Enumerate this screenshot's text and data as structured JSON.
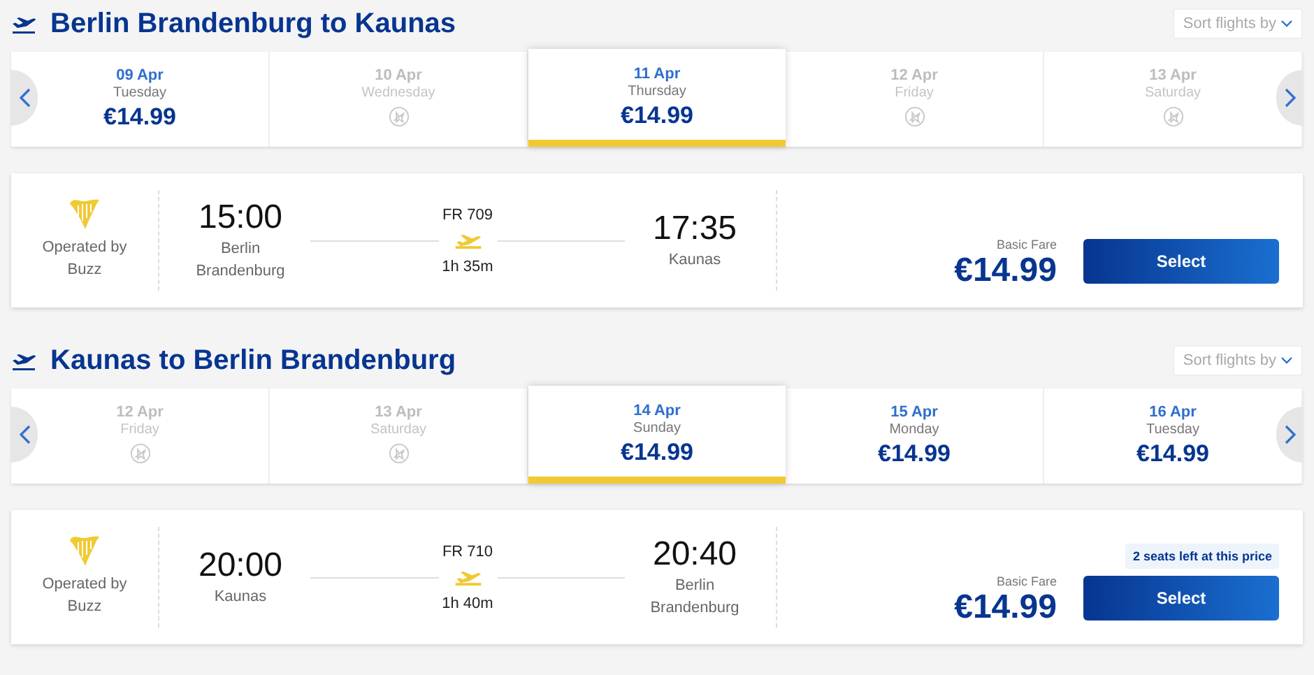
{
  "sections": [
    {
      "title": "Berlin Brandenburg to Kaunas",
      "sort_label": "Sort flights by",
      "days": [
        {
          "date": "09 Apr",
          "weekday": "Tuesday",
          "price": "€14.99",
          "available": true,
          "selected": false
        },
        {
          "date": "10 Apr",
          "weekday": "Wednesday",
          "available": false,
          "selected": false
        },
        {
          "date": "11 Apr",
          "weekday": "Thursday",
          "price": "€14.99",
          "available": true,
          "selected": true
        },
        {
          "date": "12 Apr",
          "weekday": "Friday",
          "available": false,
          "selected": false
        },
        {
          "date": "13 Apr",
          "weekday": "Saturday",
          "available": false,
          "selected": false
        }
      ],
      "flight": {
        "operator_label": "Operated by",
        "operator": "Buzz",
        "dep_time": "15:00",
        "dep_city": "Berlin Brandenburg",
        "flight_no": "FR 709",
        "duration": "1h 35m",
        "arr_time": "17:35",
        "arr_city": "Kaunas",
        "fare_label": "Basic Fare",
        "price": "€14.99",
        "button": "Select"
      }
    },
    {
      "title": "Kaunas to Berlin Brandenburg",
      "sort_label": "Sort flights by",
      "days": [
        {
          "date": "12 Apr",
          "weekday": "Friday",
          "available": false,
          "selected": false
        },
        {
          "date": "13 Apr",
          "weekday": "Saturday",
          "available": false,
          "selected": false
        },
        {
          "date": "14 Apr",
          "weekday": "Sunday",
          "price": "€14.99",
          "available": true,
          "selected": true
        },
        {
          "date": "15 Apr",
          "weekday": "Monday",
          "price": "€14.99",
          "available": true,
          "selected": false
        },
        {
          "date": "16 Apr",
          "weekday": "Tuesday",
          "price": "€14.99",
          "available": true,
          "selected": false
        }
      ],
      "flight": {
        "operator_label": "Operated by",
        "operator": "Buzz",
        "dep_time": "20:00",
        "dep_city": "Kaunas",
        "flight_no": "FR 710",
        "duration": "1h 40m",
        "arr_time": "20:40",
        "arr_city": "Berlin Brandenburg",
        "fare_label": "Basic Fare",
        "price": "€14.99",
        "seats_note": "2 seats left at this price",
        "button": "Select"
      }
    }
  ]
}
